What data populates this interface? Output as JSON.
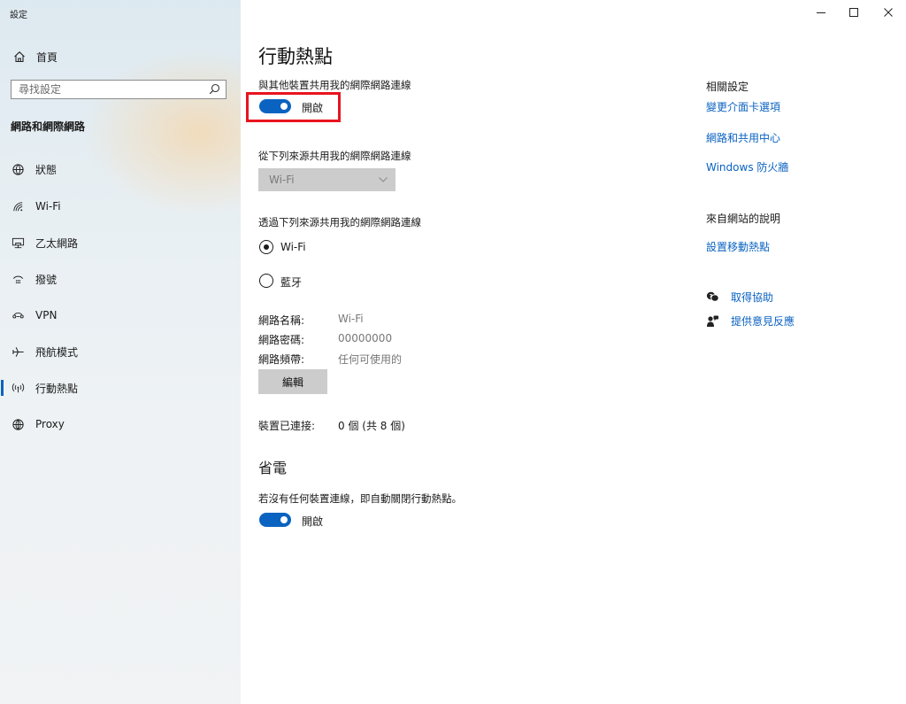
{
  "window": {
    "title": "設定",
    "controls": {
      "minimize": "–",
      "maximize": "□",
      "close": "✕"
    }
  },
  "sidebar": {
    "home_label": "首頁",
    "search_placeholder": "尋找設定",
    "section_title": "網路和網際網路",
    "items": [
      {
        "label": "狀態",
        "icon": "globe-status-icon"
      },
      {
        "label": "Wi-Fi",
        "icon": "wifi-icon"
      },
      {
        "label": "乙太網路",
        "icon": "ethernet-icon"
      },
      {
        "label": "撥號",
        "icon": "dialup-icon"
      },
      {
        "label": "VPN",
        "icon": "vpn-icon"
      },
      {
        "label": "飛航模式",
        "icon": "airplane-icon"
      },
      {
        "label": "行動熱點",
        "icon": "hotspot-icon",
        "active": true
      },
      {
        "label": "Proxy",
        "icon": "globe-icon"
      }
    ]
  },
  "main": {
    "title": "行動熱點",
    "share_label": "與其他裝置共用我的網際網路連線",
    "share_toggle": {
      "state_label": "開啟",
      "on": true
    },
    "source_label": "從下列來源共用我的網際網路連線",
    "source_dropdown": {
      "value": "Wi-Fi"
    },
    "via_label": "透過下列來源共用我的網際網路連線",
    "via_options": [
      {
        "label": "Wi-Fi",
        "checked": true
      },
      {
        "label": "藍牙",
        "checked": false
      }
    ],
    "network_info": [
      {
        "key": "網路名稱:",
        "value": "Wi-Fi"
      },
      {
        "key": "網路密碼:",
        "value": "00000000"
      },
      {
        "key": "網路頻帶:",
        "value": "任何可使用的"
      }
    ],
    "edit_button": "編輯",
    "connected_key": "裝置已連接:",
    "connected_value": "0 個 (共 8 個)",
    "power_section": {
      "title": "省電",
      "description": "若沒有任何裝置連線，即自動關閉行動熱點。",
      "toggle": {
        "state_label": "開啟",
        "on": true
      }
    }
  },
  "right": {
    "related_title": "相關設定",
    "related_links": [
      "變更介面卡選項",
      "網路和共用中心",
      "Windows 防火牆"
    ],
    "web_help_title": "來自網站的說明",
    "web_help_links": [
      "設置移動熱點"
    ],
    "help_actions": [
      {
        "label": "取得協助",
        "icon": "get-help-icon"
      },
      {
        "label": "提供意見反應",
        "icon": "feedback-icon"
      }
    ]
  },
  "colors": {
    "accent": "#0b63c1",
    "link": "#0a62c1",
    "highlight": "#e8141e"
  }
}
